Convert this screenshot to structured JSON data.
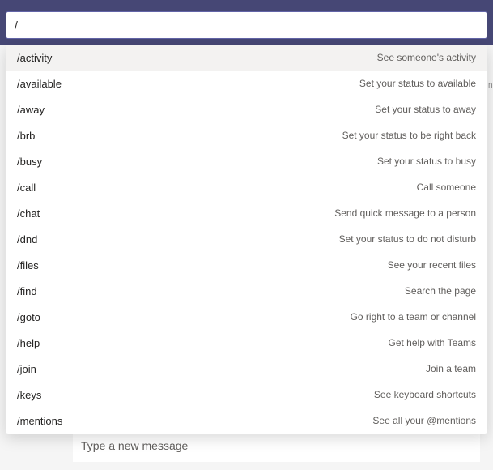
{
  "search": {
    "value": "/"
  },
  "commands": [
    {
      "cmd": "/activity",
      "desc": "See someone's activity",
      "highlighted": true
    },
    {
      "cmd": "/available",
      "desc": "Set your status to available",
      "highlighted": false
    },
    {
      "cmd": "/away",
      "desc": "Set your status to away",
      "highlighted": false
    },
    {
      "cmd": "/brb",
      "desc": "Set your status to be right back",
      "highlighted": false
    },
    {
      "cmd": "/busy",
      "desc": "Set your status to busy",
      "highlighted": false
    },
    {
      "cmd": "/call",
      "desc": "Call someone",
      "highlighted": false
    },
    {
      "cmd": "/chat",
      "desc": "Send quick message to a person",
      "highlighted": false
    },
    {
      "cmd": "/dnd",
      "desc": "Set your status to do not disturb",
      "highlighted": false
    },
    {
      "cmd": "/files",
      "desc": "See your recent files",
      "highlighted": false
    },
    {
      "cmd": "/find",
      "desc": "Search the page",
      "highlighted": false
    },
    {
      "cmd": "/goto",
      "desc": "Go right to a team or channel",
      "highlighted": false
    },
    {
      "cmd": "/help",
      "desc": "Get help with Teams",
      "highlighted": false
    },
    {
      "cmd": "/join",
      "desc": "Join a team",
      "highlighted": false
    },
    {
      "cmd": "/keys",
      "desc": "See keyboard shortcuts",
      "highlighted": false
    },
    {
      "cmd": "/mentions",
      "desc": "See all your @mentions",
      "highlighted": false
    }
  ],
  "compose": {
    "placeholder": "Type a new message"
  },
  "edge_text": "n"
}
